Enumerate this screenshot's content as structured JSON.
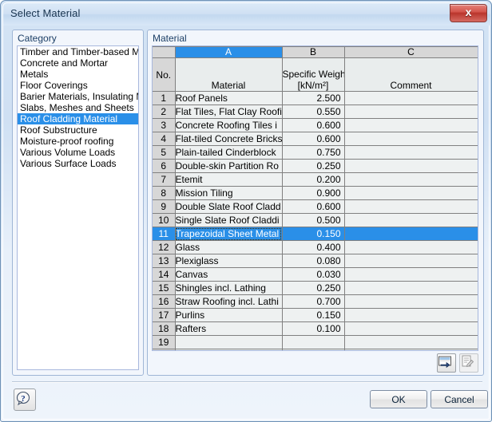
{
  "window": {
    "title": "Select Material",
    "close_label": "x"
  },
  "category_panel": {
    "label": "Category",
    "items": [
      {
        "label": "Timber and Timber-based Mater",
        "selected": false
      },
      {
        "label": "Concrete and Mortar",
        "selected": false
      },
      {
        "label": "Metals",
        "selected": false
      },
      {
        "label": "Floor Coverings",
        "selected": false
      },
      {
        "label": "Barier Materials, Insulating Mate",
        "selected": false
      },
      {
        "label": "Slabs, Meshes and Sheets",
        "selected": false
      },
      {
        "label": "Roof Cladding Material",
        "selected": true
      },
      {
        "label": "Roof Substructure",
        "selected": false
      },
      {
        "label": "Moisture-proof roofing",
        "selected": false
      },
      {
        "label": "Various Volume Loads",
        "selected": false
      },
      {
        "label": "Various Surface Loads",
        "selected": false
      }
    ]
  },
  "material_panel": {
    "label": "Material",
    "column_letters": {
      "no": "",
      "a": "A",
      "b": "B",
      "c": "C"
    },
    "column_titles": {
      "no": "No.",
      "a": "Material",
      "b_line1": "Specific Weight",
      "b_line2": "[kN/m²]",
      "c": "Comment"
    },
    "rows": [
      {
        "no": "1",
        "material": "Roof Panels",
        "weight": "2.500",
        "comment": "",
        "selected": false
      },
      {
        "no": "2",
        "material": "Flat Tiles, Flat Clay Roofi",
        "weight": "0.550",
        "comment": "",
        "selected": false
      },
      {
        "no": "3",
        "material": "Concrete Roofing Tiles i",
        "weight": "0.600",
        "comment": "",
        "selected": false
      },
      {
        "no": "4",
        "material": "Flat-tiled Concrete Bricks",
        "weight": "0.600",
        "comment": "",
        "selected": false
      },
      {
        "no": "5",
        "material": "Plain-tailed Cinderblock",
        "weight": "0.750",
        "comment": "",
        "selected": false
      },
      {
        "no": "6",
        "material": "Double-skin Partition Ro",
        "weight": "0.250",
        "comment": "",
        "selected": false
      },
      {
        "no": "7",
        "material": "Etemit",
        "weight": "0.200",
        "comment": "",
        "selected": false
      },
      {
        "no": "8",
        "material": "Mission Tiling",
        "weight": "0.900",
        "comment": "",
        "selected": false
      },
      {
        "no": "9",
        "material": "Double Slate Roof Cladd",
        "weight": "0.600",
        "comment": "",
        "selected": false
      },
      {
        "no": "10",
        "material": "Single Slate Roof Claddi",
        "weight": "0.500",
        "comment": "",
        "selected": false
      },
      {
        "no": "11",
        "material": "Trapezoidal Sheet Metal",
        "weight": "0.150",
        "comment": "",
        "selected": true
      },
      {
        "no": "12",
        "material": "Glass",
        "weight": "0.400",
        "comment": "",
        "selected": false
      },
      {
        "no": "13",
        "material": "Plexiglass",
        "weight": "0.080",
        "comment": "",
        "selected": false
      },
      {
        "no": "14",
        "material": "Canvas",
        "weight": "0.030",
        "comment": "",
        "selected": false
      },
      {
        "no": "15",
        "material": "Shingles incl. Lathing",
        "weight": "0.250",
        "comment": "",
        "selected": false
      },
      {
        "no": "16",
        "material": "Straw Roofing incl. Lathi",
        "weight": "0.700",
        "comment": "",
        "selected": false
      },
      {
        "no": "17",
        "material": "Purlins",
        "weight": "0.150",
        "comment": "",
        "selected": false
      },
      {
        "no": "18",
        "material": "Rafters",
        "weight": "0.100",
        "comment": "",
        "selected": false
      },
      {
        "no": "19",
        "material": "",
        "weight": "",
        "comment": "",
        "selected": false
      }
    ],
    "toolbar": {
      "import_icon": "import-table-icon",
      "edit_icon": "edit-note-icon"
    }
  },
  "footer": {
    "help_icon": "help-question-icon",
    "ok_label": "OK",
    "cancel_label": "Cancel"
  },
  "colors": {
    "selection_blue": "#2a8fe8",
    "titlebar_blue": "#cfe0f3",
    "close_red": "#b9352c",
    "header_gray": "#d7d7d7",
    "cell_bg": "#eef1f1"
  }
}
